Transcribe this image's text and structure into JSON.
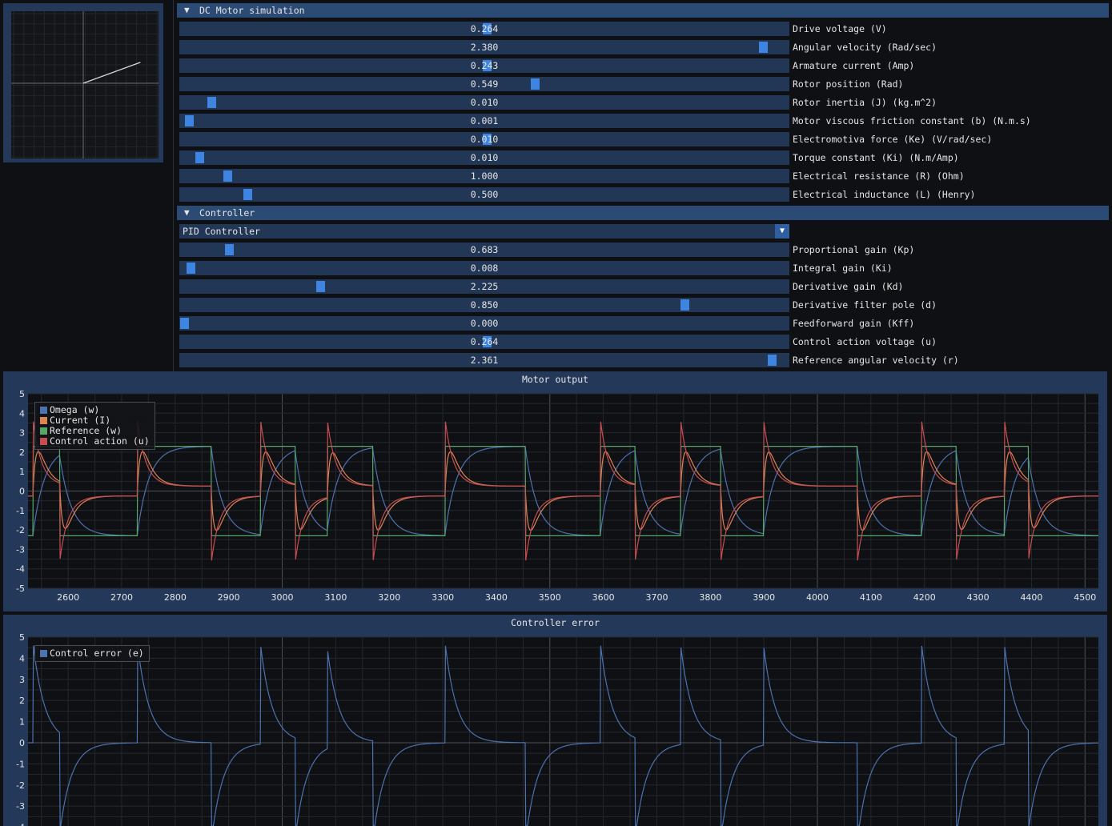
{
  "phase_plot": {
    "trajectory_end": {
      "x": 2.38,
      "y": 0.264
    },
    "axis_range": 3.0
  },
  "motor_section": {
    "title": "DC Motor simulation",
    "rows": [
      {
        "value": "0.264",
        "label": "Drive voltage (V)",
        "fraction": 0.505
      },
      {
        "value": "2.380",
        "label": "Angular velocity (Rad/sec)",
        "fraction": 0.965
      },
      {
        "value": "0.243",
        "label": "Armature current (Amp)",
        "fraction": 0.505
      },
      {
        "value": "0.549",
        "label": "Rotor position (Rad)",
        "fraction": 0.585
      },
      {
        "value": "0.010",
        "label": "Rotor inertia (J) (kg.m^2)",
        "fraction": 0.045
      },
      {
        "value": "0.001",
        "label": "Motor viscous friction constant (b) (N.m.s)",
        "fraction": 0.008
      },
      {
        "value": "0.010",
        "label": "Electromotiva force (Ke) (V/rad/sec)",
        "fraction": 0.505
      },
      {
        "value": "0.010",
        "label": "Torque constant (Ki) (N.m/Amp)",
        "fraction": 0.025
      },
      {
        "value": "1.000",
        "label": "Electrical resistance (R) (Ohm)",
        "fraction": 0.072
      },
      {
        "value": "0.500",
        "label": "Electrical inductance (L) (Henry)",
        "fraction": 0.105
      }
    ]
  },
  "controller_section": {
    "title": "Controller",
    "combo": {
      "selected": "PID Controller"
    },
    "rows": [
      {
        "value": "0.683",
        "label": "Proportional gain (Kp)",
        "fraction": 0.075
      },
      {
        "value": "0.008",
        "label": "Integral gain (Ki)",
        "fraction": 0.011
      },
      {
        "value": "2.225",
        "label": "Derivative gain (Kd)",
        "fraction": 0.227
      },
      {
        "value": "0.850",
        "label": "Derivative filter pole (d)",
        "fraction": 0.835
      },
      {
        "value": "0.000",
        "label": "Feedforward gain (Kff)",
        "fraction": 0.0
      },
      {
        "value": "0.264",
        "label": "Control action voltage (u)",
        "fraction": 0.505
      },
      {
        "value": "2.361",
        "label": "Reference angular velocity (r)",
        "fraction": 0.98
      }
    ]
  },
  "colors": {
    "omega": "#4c72b0",
    "current": "#dd8452",
    "reference": "#55a868",
    "control": "#c44e52",
    "error": "#4c72b0"
  },
  "chart_data": [
    {
      "type": "line",
      "title": "Motor output",
      "xlim": [
        2525,
        4525
      ],
      "ylim": [
        -5,
        5
      ],
      "xticks": [
        2600,
        2700,
        2800,
        2900,
        3000,
        3100,
        3200,
        3300,
        3400,
        3500,
        3600,
        3700,
        3800,
        3900,
        4000,
        4100,
        4200,
        4300,
        4400,
        4500
      ],
      "yticks": [
        -5,
        -4,
        -3,
        -2,
        -1,
        0,
        1,
        2,
        3,
        4,
        5
      ],
      "legend": "top-left",
      "reference_switch_times": [
        2535,
        2585,
        2730,
        2868,
        2960,
        3025,
        3085,
        3170,
        3305,
        3455,
        3595,
        3660,
        3745,
        3820,
        3900,
        4075,
        4195,
        4260,
        4350,
        4395
      ],
      "reference_levels": [
        2.3,
        -2.3
      ],
      "series": [
        {
          "name": "Omega (w)",
          "key": "omega"
        },
        {
          "name": "Current (I)",
          "key": "current"
        },
        {
          "name": "Reference (w)",
          "key": "reference"
        },
        {
          "name": "Control action (u)",
          "key": "control"
        }
      ]
    },
    {
      "type": "line",
      "title": "Controller error",
      "xlim": [
        2525,
        4525
      ],
      "ylim": [
        -5,
        5
      ],
      "yticks": [
        -4,
        -3,
        -2,
        -1,
        0,
        1,
        2,
        3,
        4,
        5
      ],
      "legend": "top-left",
      "series": [
        {
          "name": "Control error (e)",
          "key": "error"
        }
      ]
    }
  ]
}
